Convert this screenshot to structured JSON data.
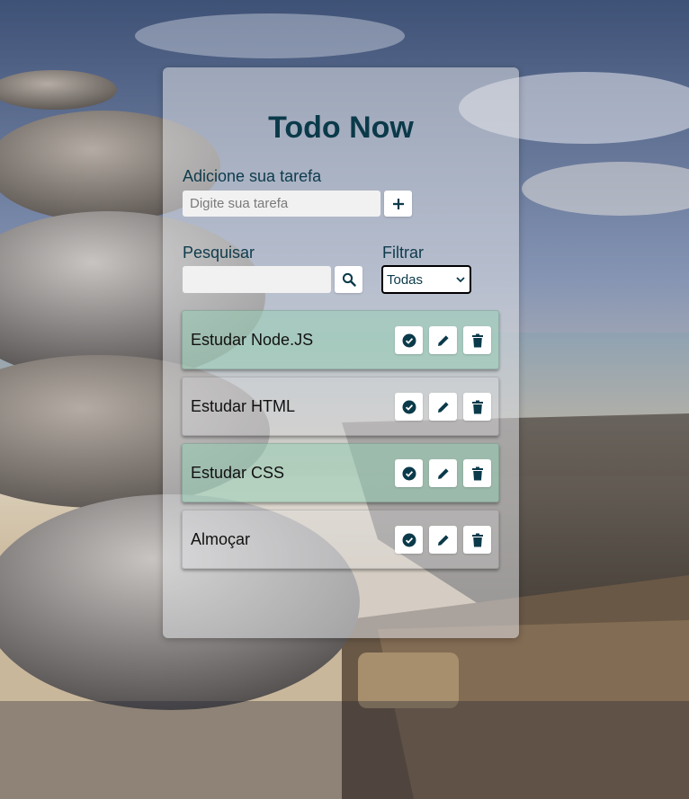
{
  "app": {
    "title": "Todo Now"
  },
  "add": {
    "label": "Adicione sua tarefa",
    "placeholder": "Digite sua tarefa",
    "button_icon": "plus-icon"
  },
  "search": {
    "label": "Pesquisar",
    "value": "",
    "button_icon": "search-icon"
  },
  "filter": {
    "label": "Filtrar",
    "selected": "Todas",
    "icon": "chevron-down-icon"
  },
  "todos": [
    {
      "text": "Estudar Node.JS",
      "done": true
    },
    {
      "text": "Estudar HTML",
      "done": false
    },
    {
      "text": "Estudar CSS",
      "done": true
    },
    {
      "text": "Almoçar",
      "done": false
    }
  ],
  "todo_actions": {
    "complete_icon": "check-circle-icon",
    "edit_icon": "pencil-icon",
    "delete_icon": "trash-icon"
  },
  "colors": {
    "accent": "#0b3a4a",
    "done_background": "#96cdb4",
    "card_background": "#dee0e4"
  }
}
